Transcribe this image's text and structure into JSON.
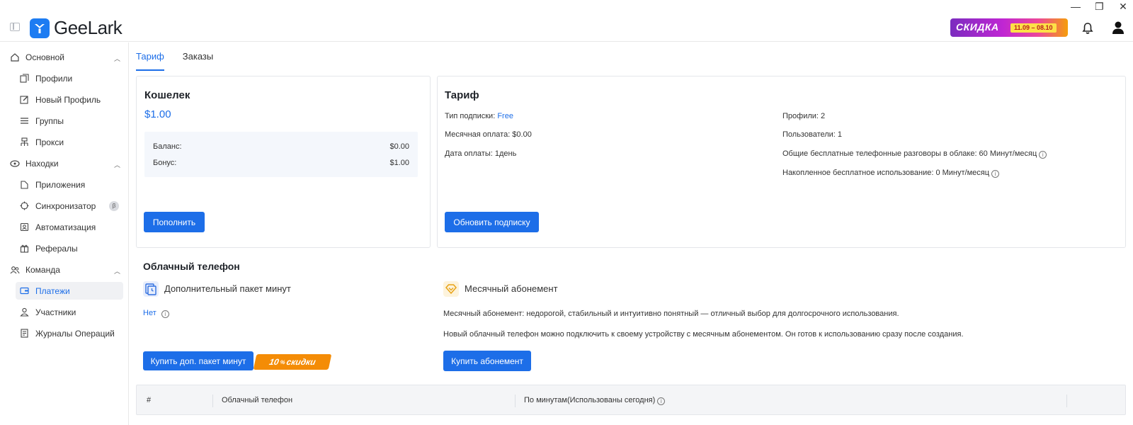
{
  "window": {
    "minimize": "—",
    "restore": "❐",
    "close": "✕"
  },
  "app": {
    "name": "GeeLark"
  },
  "header": {
    "promo": {
      "label": "СКИДКА",
      "dates": "11.09 – 08.10"
    }
  },
  "sidebar": {
    "groups": [
      {
        "label": "Основной",
        "icon": "home-icon"
      },
      {
        "label": "Находки",
        "icon": "discover-icon"
      },
      {
        "label": "Команда",
        "icon": "team-icon"
      }
    ],
    "items": [
      {
        "label": "Профили",
        "icon": "profiles-icon"
      },
      {
        "label": "Новый Профиль",
        "icon": "new-profile-icon"
      },
      {
        "label": "Группы",
        "icon": "groups-icon"
      },
      {
        "label": "Прокси",
        "icon": "proxy-icon"
      },
      {
        "label": "Приложения",
        "icon": "apps-icon"
      },
      {
        "label": "Синхронизатор",
        "icon": "sync-icon",
        "badge": "β"
      },
      {
        "label": "Автоматизация",
        "icon": "automation-icon"
      },
      {
        "label": "Рефералы",
        "icon": "gift-icon"
      },
      {
        "label": "Платежи",
        "icon": "payments-icon",
        "active": true
      },
      {
        "label": "Участники",
        "icon": "members-icon"
      },
      {
        "label": "Журналы Операций",
        "icon": "logs-icon"
      }
    ]
  },
  "tabs": [
    {
      "label": "Тариф",
      "active": true
    },
    {
      "label": "Заказы"
    }
  ],
  "wallet": {
    "title": "Кошелек",
    "amount": "$1.00",
    "balance_label": "Баланс:",
    "balance_value": "$0.00",
    "bonus_label": "Бонус:",
    "bonus_value": "$1.00",
    "topup_button": "Пополнить"
  },
  "plan": {
    "title": "Тариф",
    "sub_type_label": "Тип подписки:",
    "sub_type_value": "Free",
    "monthly_fee": "Месячная оплата: $0.00",
    "pay_date": "Дата оплаты: 1день",
    "profiles": "Профили: 2",
    "users": "Пользователи: 1",
    "free_calls": "Общие бесплатные телефонные разговоры в облаке: 60 Минут/месяц",
    "accumulated": "Накопленное бесплатное использование: 0 Минут/месяц",
    "upgrade_button": "Обновить подписку"
  },
  "cloud_phone": {
    "title": "Облачный телефон",
    "package": {
      "title": "Дополнительный пакет минут",
      "status": "Нет",
      "buy_button": "Купить доп. пакет минут",
      "discount_number": "10",
      "discount_unit": "%",
      "discount_text": "скидки"
    },
    "monthly": {
      "title": "Месячный абонемент",
      "desc1": "Месячный абонемент: недорогой, стабильный и интуитивно понятный — отличный выбор для долгосрочного использования.",
      "desc2": "Новый облачный телефон можно подключить к своему устройству с месячным абонементом. Он готов к использованию сразу после создания.",
      "buy_button": "Купить абонемент"
    }
  },
  "table": {
    "columns": [
      "#",
      "Облачный телефон",
      "По минутам(Использованы сегодня)"
    ]
  },
  "colors": {
    "accent": "#1d6ee8",
    "promo_start": "#7b2cbf",
    "discount": "#f48c06"
  }
}
